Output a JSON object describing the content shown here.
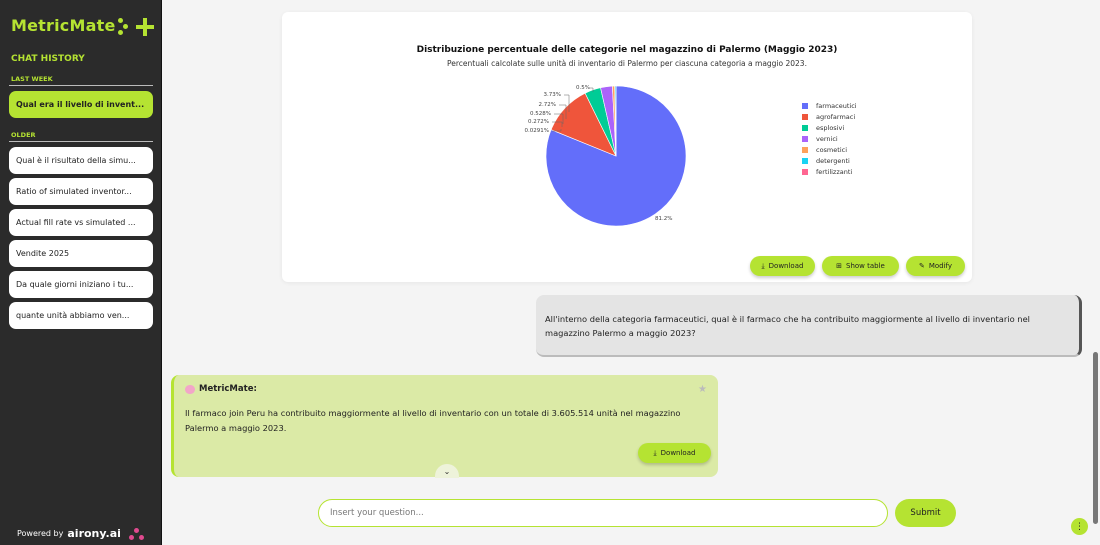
{
  "sidebar": {
    "brand": "MetricMate",
    "chat_history_title": "CHAT HISTORY",
    "last_week_label": "LAST WEEK",
    "older_label": "OLDER",
    "last_week_items": [
      {
        "label": "Qual era il livello di invent..."
      }
    ],
    "older_items": [
      {
        "label": "Qual è il risultato della simu..."
      },
      {
        "label": "Ratio of simulated inventor..."
      },
      {
        "label": "Actual fill rate vs simulated ..."
      },
      {
        "label": "Vendite 2025"
      },
      {
        "label": "Da quale giorni iniziano i tu..."
      },
      {
        "label": "quante unità abbiamo ven..."
      }
    ],
    "powered_by": "Powered by",
    "powered_brand": "airony.ai"
  },
  "chart_card": {
    "buttons": {
      "download": "Download",
      "show_table": "Show table",
      "modify": "Modify"
    }
  },
  "chart_data": {
    "type": "pie",
    "title": "Distribuzione percentuale delle categorie nel magazzino di Palermo (Maggio 2023)",
    "subtitle": "Percentuali calcolate sulle unità di inventario di Palermo per ciascuna categoria a maggio 2023.",
    "legend_position": "right",
    "slices": [
      {
        "label": "farmaceutici",
        "value": 81.2,
        "display": "81.2%",
        "color": "#636efa"
      },
      {
        "label": "agrofarmaci",
        "value": 11.6,
        "display": "",
        "color": "#ef553b"
      },
      {
        "label": "esplosivi",
        "value": 3.73,
        "display": "3.73%",
        "color": "#00cc96"
      },
      {
        "label": "vernici",
        "value": 2.72,
        "display": "2.72%",
        "color": "#ab63fa"
      },
      {
        "label": "cosmetici",
        "value": 0.528,
        "display": "0.528%",
        "color": "#ffa15a"
      },
      {
        "label": "detergenti",
        "value": 0.272,
        "display": "0.272%",
        "color": "#19d3f3"
      },
      {
        "label": "fertilizzanti",
        "value": 0.0291,
        "display": "0.0291%",
        "color": "#ff6692"
      }
    ],
    "extra_label": "0.5%"
  },
  "user_message": {
    "text": "All'interno della categoria farmaceutici, qual è il farmaco che ha contribuito maggiormente al livello di inventario nel magazzino Palermo a maggio 2023?"
  },
  "bot_message": {
    "sender": "MetricMate:",
    "text": "Il farmaco join Peru ha contribuito maggiormente al livello di inventario con un totale di 3.605.514 unità nel magazzino Palermo a maggio 2023.",
    "download_label": "Download"
  },
  "input": {
    "placeholder": "Insert your question...",
    "value": ""
  },
  "submit_label": "Submit",
  "colors": {
    "accent": "#b5e332",
    "sidebar_bg": "#2b2b2b",
    "bot_bg": "#dbeaa6",
    "user_bg": "#e4e4e4"
  }
}
